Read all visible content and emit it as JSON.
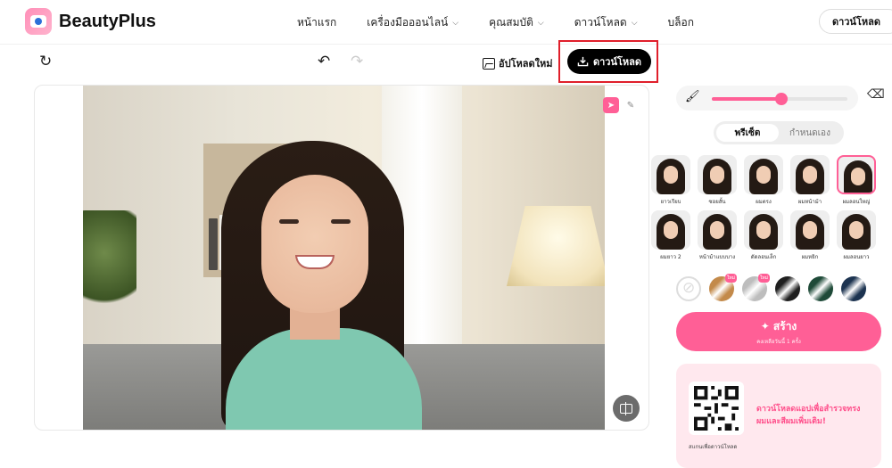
{
  "app": {
    "name": "BeautyPlus"
  },
  "nav": {
    "items": [
      {
        "label": "หน้าแรก",
        "dropdown": false
      },
      {
        "label": "เครื่องมือออนไลน์",
        "dropdown": true
      },
      {
        "label": "คุณสมบัติ",
        "dropdown": true
      },
      {
        "label": "ดาวน์โหลด",
        "dropdown": true
      },
      {
        "label": "บล็อก",
        "dropdown": false
      }
    ],
    "download_button": "ดาวน์โหลด"
  },
  "toolbar": {
    "upload_label": "อัปโหลดใหม่",
    "download_label": "ดาวน์โหลด"
  },
  "brush": {
    "size_fraction": 0.51
  },
  "tabs": {
    "preset": "พรีเซ็ต",
    "custom": "กำหนดเอง",
    "active": "preset"
  },
  "styles_row1": [
    {
      "label": "ยาวเรียบ"
    },
    {
      "label": "ซอยสั้น"
    },
    {
      "label": "ผมตรง"
    },
    {
      "label": "ผมหน้าม้า"
    },
    {
      "label": "ผมลอนใหญ่",
      "selected": true
    }
  ],
  "styles_row2": [
    {
      "label": "ผมยาว 2"
    },
    {
      "label": "หน้าม้าแบบบาง"
    },
    {
      "label": "ดัดลอนเล็ก"
    },
    {
      "label": "ผมหยิก"
    },
    {
      "label": "ผมลอนยาว"
    }
  ],
  "hair_colors": [
    {
      "name": "none",
      "color": "#ffffff",
      "new": false
    },
    {
      "name": "honey-blonde",
      "color": "#c38a4a",
      "new": true
    },
    {
      "name": "silver",
      "color": "#bdbdbd",
      "new": true
    },
    {
      "name": "black",
      "color": "#1f1f1f",
      "new": false
    },
    {
      "name": "dark-green",
      "color": "#1e4a38",
      "new": false
    },
    {
      "name": "dark-blue",
      "color": "#1c3350",
      "new": false
    }
  ],
  "new_badge": "ใหม่",
  "create": {
    "label": "สร้าง",
    "sub": "คงเหลือวันนี้ 1 ครั้ง"
  },
  "promo": {
    "text_line1": "ดาวน์โหลดแอปเพื่อสำรวจทรง",
    "text_line2": "ผมและสีผมเพิ่มเติม!",
    "qr_caption": "สแกนเพื่อดาวน์โหลด"
  },
  "colors": {
    "accent": "#ff5f96",
    "highlight_box": "#e01f2b"
  }
}
